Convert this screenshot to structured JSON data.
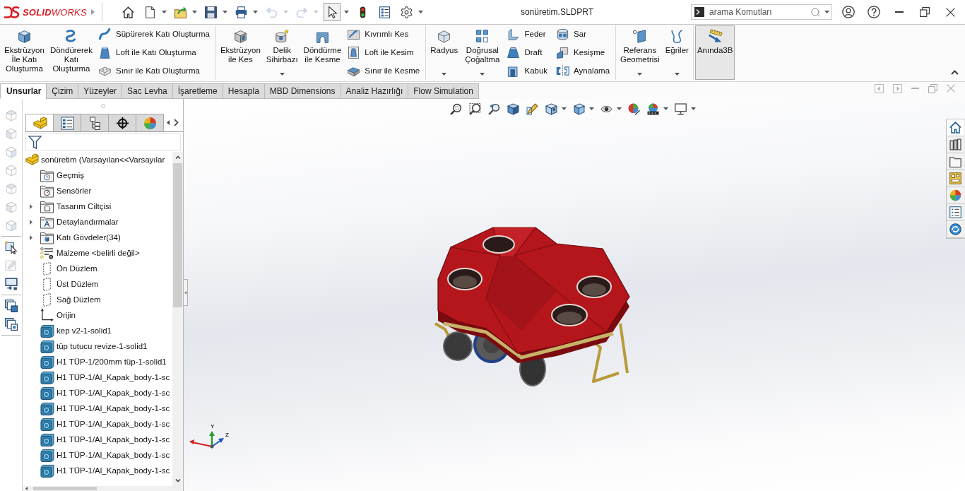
{
  "title_bar": {
    "app_name": "**SOLID**WORKS",
    "document_title": "sonüretim.SLDPRT",
    "search": {
      "placeholder": "arama Komutları"
    }
  },
  "quick_access": [
    {
      "kind": "home",
      "disabled": false,
      "pressed": false,
      "menu": false
    },
    {
      "kind": "new",
      "disabled": false,
      "pressed": false,
      "menu": true
    },
    {
      "kind": "open",
      "disabled": false,
      "pressed": false,
      "menu": true
    },
    {
      "kind": "save",
      "disabled": false,
      "pressed": false,
      "menu": true
    },
    {
      "kind": "print",
      "disabled": false,
      "pressed": false,
      "menu": true
    },
    {
      "kind": "undo",
      "disabled": true,
      "pressed": false,
      "menu": true
    },
    {
      "kind": "redo",
      "disabled": true,
      "pressed": false,
      "menu": true
    },
    {
      "kind": "select",
      "disabled": false,
      "pressed": true,
      "menu": true
    },
    {
      "kind": "rebuild",
      "disabled": false,
      "pressed": false,
      "menu": false
    },
    {
      "kind": "options",
      "disabled": false,
      "pressed": false,
      "menu": false
    },
    {
      "kind": "settings",
      "disabled": false,
      "pressed": false,
      "menu": true
    }
  ],
  "ribbon": {
    "groups": [
      {
        "items": [
          {
            "kind": "large",
            "label": "Ekstrüzyon\nİle Katı\nOluşturma",
            "pressed": false,
            "menu": false
          },
          {
            "kind": "large",
            "label": "Döndürerek\nKatı\nOluşturma",
            "pressed": false,
            "menu": false
          },
          {
            "kind": "stack",
            "items": [
              {
                "label": "Süpürerek Katı Oluşturma",
                "pressed": false
              },
              {
                "label": "Loft ile Katı Oluşturma",
                "pressed": false
              },
              {
                "label": "Sınır ile Katı Oluşturma",
                "pressed": false
              }
            ]
          }
        ]
      },
      {
        "items": [
          {
            "kind": "large",
            "label": "Ekstrüzyon\nile Kes",
            "pressed": false,
            "menu": false
          },
          {
            "kind": "large",
            "label": "Delik\nSihirbazı",
            "pressed": false,
            "menu": true
          },
          {
            "kind": "large",
            "label": "Döndürme\nile Kesme",
            "pressed": false,
            "menu": false
          },
          {
            "kind": "stack",
            "items": [
              {
                "label": "Kıvrımlı Kes",
                "pressed": false
              },
              {
                "label": "Loft ile Kesim",
                "pressed": false
              },
              {
                "label": "Sınır ile Kesme",
                "pressed": false
              }
            ]
          }
        ]
      },
      {
        "items": [
          {
            "kind": "large",
            "label": "Radyus",
            "pressed": false,
            "menu": true
          },
          {
            "kind": "large",
            "label": "Doğrusal\nÇoğaltma",
            "pressed": false,
            "menu": true
          },
          {
            "kind": "stack",
            "items": [
              {
                "label": "Feder",
                "pressed": false
              },
              {
                "label": "Draft",
                "pressed": false
              },
              {
                "label": "Kabuk",
                "pressed": false
              }
            ]
          },
          {
            "kind": "stack",
            "items": [
              {
                "label": "Sar",
                "pressed": false
              },
              {
                "label": "Kesişme",
                "pressed": false
              },
              {
                "label": "Aynalama",
                "pressed": false
              }
            ]
          }
        ]
      },
      {
        "items": [
          {
            "kind": "large",
            "label": "Referans\nGeometrisi",
            "pressed": false,
            "menu": true
          },
          {
            "kind": "large",
            "label": "Eğriler",
            "pressed": false,
            "menu": true
          }
        ]
      },
      {
        "items": [
          {
            "kind": "large",
            "label": "Anında3B",
            "pressed": true,
            "menu": false
          }
        ]
      }
    ]
  },
  "command_tabs": [
    {
      "label": "Unsurlar",
      "selected": true
    },
    {
      "label": "Çizim",
      "selected": false
    },
    {
      "label": "Yüzeyler",
      "selected": false
    },
    {
      "label": "Sac Levha",
      "selected": false
    },
    {
      "label": "İşaretleme",
      "selected": false
    },
    {
      "label": "Hesapla",
      "selected": false
    },
    {
      "label": "MBD Dimensions",
      "selected": false
    },
    {
      "label": "Analiz Hazırlığı",
      "selected": false
    },
    {
      "label": "Flow Simulation",
      "selected": false
    }
  ],
  "side_toolbar": {
    "groups": [
      {
        "items": [
          {
            "disabled": true
          },
          {
            "disabled": true
          },
          {
            "disabled": true
          },
          {
            "disabled": true
          },
          {
            "disabled": true
          },
          {
            "disabled": true
          },
          {
            "disabled": true
          }
        ]
      },
      {
        "items": [
          {
            "disabled": false
          },
          {
            "disabled": true
          },
          {
            "disabled": false
          }
        ]
      },
      {
        "items": [
          {
            "disabled": false
          },
          {
            "disabled": false
          }
        ]
      }
    ]
  },
  "feature_manager": {
    "tabs": [
      {
        "selected": true
      },
      {
        "selected": false
      },
      {
        "selected": false
      },
      {
        "selected": false
      },
      {
        "selected": false
      }
    ],
    "tree": {
      "root": "sonüretim (Varsayılan<<Varsayılar",
      "children": [
        {
          "kind": "history",
          "label": "Geçmiş",
          "collapsed": false
        },
        {
          "kind": "sensors",
          "label": "Sensörler",
          "collapsed": false
        },
        {
          "kind": "binder",
          "label": "Tasarım Ciltçisi",
          "collapsed": true
        },
        {
          "kind": "annotations",
          "label": "Detaylandırmalar",
          "collapsed": true
        },
        {
          "kind": "bodies",
          "label": "Katı Gövdeler(34)",
          "collapsed": true
        },
        {
          "kind": "material",
          "label": "Malzeme <belirli değil>",
          "collapsed": false
        },
        {
          "kind": "plane",
          "label": "Ön Düzlem",
          "collapsed": false
        },
        {
          "kind": "plane",
          "label": "Üst Düzlem",
          "collapsed": false
        },
        {
          "kind": "plane",
          "label": "Sağ Düzlem",
          "collapsed": false
        },
        {
          "kind": "origin",
          "label": "Orijin",
          "collapsed": false
        },
        {
          "kind": "body",
          "label": "kep v2-1-solid1",
          "collapsed": false
        },
        {
          "kind": "body",
          "label": "tüp tutucu revize-1-solid1",
          "collapsed": false
        },
        {
          "kind": "body",
          "label": "H1 TÜP-1/200mm tüp-1-solid1",
          "collapsed": false
        },
        {
          "kind": "body",
          "label": "H1 TÜP-1/Al_Kapak_body-1-sc",
          "collapsed": false
        },
        {
          "kind": "body",
          "label": "H1 TÜP-1/Al_Kapak_body-1-sc",
          "collapsed": false
        },
        {
          "kind": "body",
          "label": "H1 TÜP-1/Al_Kapak_body-1-sc",
          "collapsed": false
        },
        {
          "kind": "body",
          "label": "H1 TÜP-1/Al_Kapak_body-1-sc",
          "collapsed": false
        },
        {
          "kind": "body",
          "label": "H1 TÜP-1/Al_Kapak_body-1-sc",
          "collapsed": false
        },
        {
          "kind": "body",
          "label": "H1 TÜP-1/Al_Kapak_body-1-sc",
          "collapsed": false
        },
        {
          "kind": "body",
          "label": "H1 TÜP-1/Al_Kapak_body-1-sc",
          "collapsed": false
        }
      ]
    }
  },
  "view_toolbar": [
    {
      "menu": false
    },
    {
      "menu": false
    },
    {
      "menu": false
    },
    {
      "menu": false
    },
    {
      "menu": false
    },
    {
      "menu": true
    },
    {
      "menu": true
    },
    {
      "menu": true
    },
    {
      "menu": false
    },
    {
      "menu": true
    },
    {
      "menu": true
    }
  ],
  "triad": {
    "labels": [
      "Y",
      "Z"
    ]
  }
}
